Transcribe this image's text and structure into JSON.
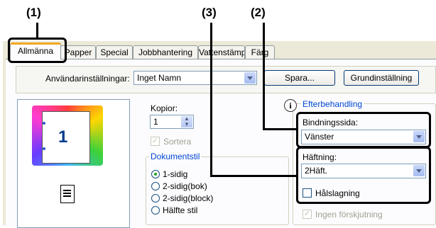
{
  "callouts": [
    "(1)",
    "(3)",
    "(2)"
  ],
  "tabs": [
    {
      "label": "Allmänna",
      "active": true
    },
    {
      "label": "Papper"
    },
    {
      "label": "Special"
    },
    {
      "label": "Jobbhantering"
    },
    {
      "label": "Vattenstämpel"
    },
    {
      "label": "Färg"
    }
  ],
  "user_settings": {
    "label": "Användarinställningar:",
    "value": "Inget Namn",
    "save": "Spara...",
    "default": "Grundinställning"
  },
  "preview": {
    "page_number": "1"
  },
  "copies": {
    "label": "Kopior:",
    "value": "1",
    "collate": "Sortera"
  },
  "document_style": {
    "title": "Dokumentstil",
    "options": [
      {
        "label": "1-sidig",
        "selected": true
      },
      {
        "label": "2-sidig(bok)"
      },
      {
        "label": "2-sidig(block)"
      },
      {
        "label": "Hälfte stil"
      }
    ]
  },
  "finishing": {
    "title": "Efterbehandling",
    "binding_edge_label": "Bindningssida:",
    "binding_edge_value": "Vänster",
    "staple_label": "Häftning:",
    "staple_value": "2Häft.",
    "punch_label": "Hålslagning",
    "no_offset_label": "Ingen förskjutning"
  },
  "colors": {
    "highlight": "#000000",
    "tab_accent": "#f5a623",
    "group_title": "#0046d5"
  }
}
